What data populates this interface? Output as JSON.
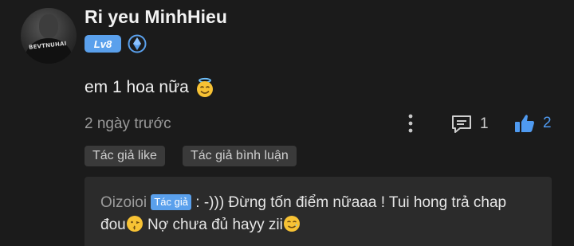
{
  "comment": {
    "username": "Ri yeu MinhHieu",
    "level": "Lv8",
    "avatar_shirt_text": "BEVTNUHAI",
    "text": "em 1 hoa nữa",
    "emoji": "innocent-smile",
    "timestamp": "2 ngày trước",
    "reply_count": "1",
    "like_count": "2",
    "liked": true
  },
  "tags": {
    "author_like": "Tác giả like",
    "author_comment": "Tác giả bình luận"
  },
  "reply": {
    "author": "Oizoioi",
    "author_badge": "Tác giả",
    "text_part1": ": -))) Đừng tốn điểm nữaaa ! Tui hong trả chap đou",
    "text_part2": " Nợ chưa đủ hayy zii"
  },
  "colors": {
    "background": "#1b1b1b",
    "accent": "#5aa0ec",
    "like_active": "#4f9af0",
    "reply_box": "#2b2b2b",
    "tag_bg": "#3a3a3a"
  }
}
